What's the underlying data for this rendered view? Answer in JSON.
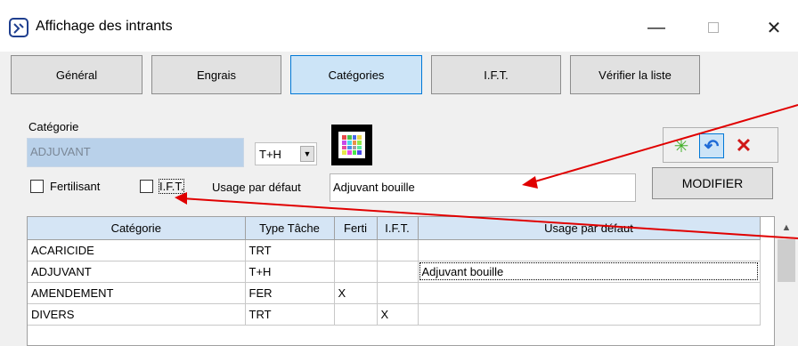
{
  "window": {
    "title": "Affichage des intrants",
    "minimize_glyph": "—",
    "close_glyph": "✕"
  },
  "tabs": [
    {
      "label": "Général",
      "active": false
    },
    {
      "label": "Engrais",
      "active": false
    },
    {
      "label": "Catégories",
      "active": true
    },
    {
      "label": "I.F.T.",
      "active": false
    },
    {
      "label": "Vérifier la liste",
      "active": false
    }
  ],
  "form": {
    "categorie_label": "Catégorie",
    "categorie_value": "ADJUVANT",
    "type_value": "T+H",
    "fertilisant_label": "Fertilisant",
    "fertilisant_checked": false,
    "ift_label": "I.F.T.",
    "ift_checked": false,
    "usage_label": "Usage par défaut",
    "usage_value": "Adjuvant bouille"
  },
  "actions": {
    "refresh_icon": "refresh-icon",
    "undo_icon": "undo-icon",
    "cancel_icon": "cancel-icon",
    "modify_label": "MODIFIER"
  },
  "grid": {
    "columns": [
      "Catégorie",
      "Type Tâche",
      "Ferti",
      "I.F.T.",
      "Usage par défaut"
    ],
    "rows": [
      [
        "ACARICIDE",
        "TRT",
        "",
        "",
        ""
      ],
      [
        "ADJUVANT",
        "T+H",
        "",
        "",
        "Adjuvant bouille"
      ],
      [
        "AMENDEMENT",
        "FER",
        "X",
        "",
        ""
      ],
      [
        "DIVERS",
        "TRT",
        "",
        "X",
        ""
      ]
    ]
  },
  "colors": {
    "accent": "#0078d7",
    "selected_field": "#b9d1ea",
    "header_bg": "#d5e5f5",
    "annotation_arrow": "#e00000"
  }
}
